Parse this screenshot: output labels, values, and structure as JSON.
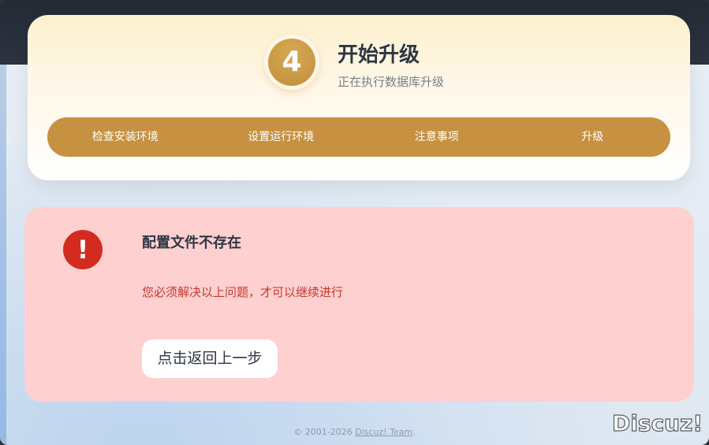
{
  "header": {
    "step_number": "4",
    "title": "开始升级",
    "subtitle": "正在执行数据库升级",
    "steps": [
      {
        "label": "检查安装环境"
      },
      {
        "label": "设置运行环境"
      },
      {
        "label": "注意事项"
      },
      {
        "label": "升级"
      }
    ]
  },
  "error": {
    "icon": "exclamation-icon",
    "title": "配置文件不存在",
    "message": "您必须解决以上问题，才可以继续进行",
    "back_label": "点击返回上一步"
  },
  "footer": {
    "copyright": "© 2001-2026 ",
    "team_link": "Discuz! Team",
    "period": "."
  },
  "logo": {
    "text": "Discuz!"
  },
  "colors": {
    "accent": "#c69140",
    "error_bg": "#ffd0d0",
    "error_text": "#c8372b",
    "error_icon": "#d42b20"
  }
}
